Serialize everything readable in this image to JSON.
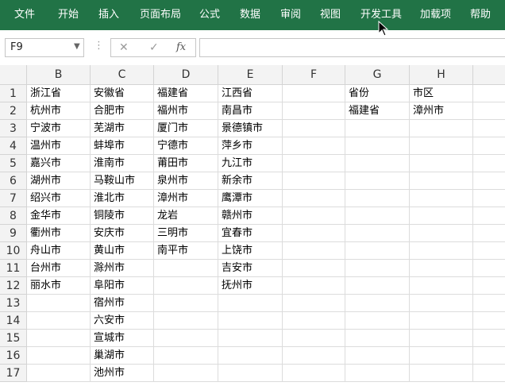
{
  "ribbon": {
    "tabs": [
      "文件",
      "开始",
      "插入",
      "页面布局",
      "公式",
      "数据",
      "审阅",
      "视图",
      "开发工具",
      "加载项",
      "帮助"
    ],
    "bg": "#217346"
  },
  "formula_bar": {
    "name_box": "F9",
    "cancel_icon": "✕",
    "enter_icon": "✓",
    "fx_label": "fx",
    "formula": ""
  },
  "sheet": {
    "columns": [
      "B",
      "C",
      "D",
      "E",
      "F",
      "G",
      "H"
    ],
    "rows": [
      "1",
      "2",
      "3",
      "4",
      "5",
      "6",
      "7",
      "8",
      "9",
      "10",
      "11",
      "12",
      "13",
      "14",
      "15",
      "16",
      "17"
    ],
    "cells": [
      [
        "浙江省",
        "安徽省",
        "福建省",
        "江西省",
        "",
        "省份",
        "市区"
      ],
      [
        "杭州市",
        "合肥市",
        "福州市",
        "南昌市",
        "",
        "福建省",
        "漳州市"
      ],
      [
        "宁波市",
        "芜湖市",
        "厦门市",
        "景德镇市",
        "",
        "",
        ""
      ],
      [
        "温州市",
        "蚌埠市",
        "宁德市",
        "萍乡市",
        "",
        "",
        ""
      ],
      [
        "嘉兴市",
        "淮南市",
        "莆田市",
        "九江市",
        "",
        "",
        ""
      ],
      [
        "湖州市",
        "马鞍山市",
        "泉州市",
        "新余市",
        "",
        "",
        ""
      ],
      [
        "绍兴市",
        "淮北市",
        "漳州市",
        "鹰潭市",
        "",
        "",
        ""
      ],
      [
        "金华市",
        "铜陵市",
        "龙岩",
        "赣州市",
        "",
        "",
        ""
      ],
      [
        "衢州市",
        "安庆市",
        "三明市",
        "宜春市",
        "",
        "",
        ""
      ],
      [
        "舟山市",
        "黄山市",
        "南平市",
        "上饶市",
        "",
        "",
        ""
      ],
      [
        "台州市",
        "滁州市",
        "",
        "吉安市",
        "",
        "",
        ""
      ],
      [
        "丽水市",
        "阜阳市",
        "",
        "抚州市",
        "",
        "",
        ""
      ],
      [
        "",
        "宿州市",
        "",
        "",
        "",
        "",
        ""
      ],
      [
        "",
        "六安市",
        "",
        "",
        "",
        "",
        ""
      ],
      [
        "",
        "宣城市",
        "",
        "",
        "",
        "",
        ""
      ],
      [
        "",
        "巢湖市",
        "",
        "",
        "",
        "",
        ""
      ],
      [
        "",
        "池州市",
        "",
        "",
        "",
        "",
        ""
      ]
    ]
  }
}
